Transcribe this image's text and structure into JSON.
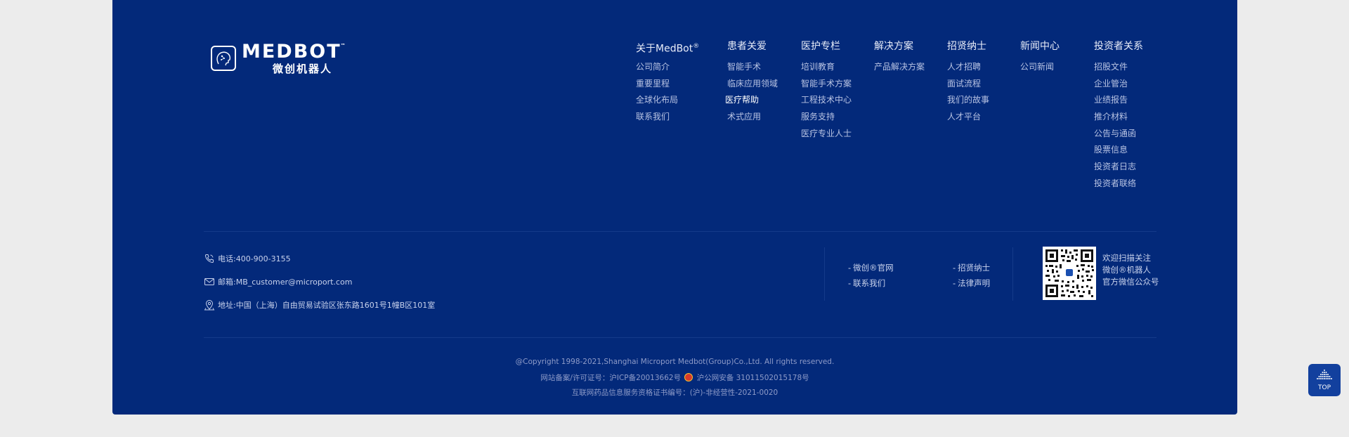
{
  "logo": {
    "text_en": "MEDBOT",
    "tm": "™",
    "text_cn": "微创机器人"
  },
  "nav": [
    {
      "title": "关于MedBot",
      "title_sup": "®",
      "items": [
        "公司简介",
        "重要里程",
        "全球化布局",
        "联系我们"
      ]
    },
    {
      "title": "患者关爱",
      "items": [
        "智能手术",
        "临床应用领域",
        "医疗帮助",
        "术式应用"
      ]
    },
    {
      "title": "医护专栏",
      "items": [
        "培训教育",
        "智能手术方案",
        "工程技术中心",
        "服务支持",
        "医疗专业人士"
      ]
    },
    {
      "title": "解决方案",
      "items": [
        "产品解决方案"
      ]
    },
    {
      "title": "招贤纳士",
      "items": [
        "人才招聘",
        "面试流程",
        "我们的故事",
        "人才平台"
      ]
    },
    {
      "title": "新闻中心",
      "items": [
        "公司新闻"
      ]
    },
    {
      "title": "投资者关系",
      "items": [
        "招股文件",
        "企业管治",
        "业绩报告",
        "推介材料",
        "公告与通函",
        "股票信息",
        "投资者日志",
        "投资者联络"
      ]
    }
  ],
  "contact": {
    "phone": "电话:400-900-3155",
    "email": "邮箱:MB_customer@microport.com",
    "address": "地址:中国（上海）自由贸易试验区张东路1601号1幢B区101室"
  },
  "links": {
    "dash": "-",
    "official_site": "微创®官网",
    "recruit": "招贤纳士",
    "contact_us": "联系我们",
    "legal": "法律声明"
  },
  "qr": {
    "caption_1": "欢迎扫描关注",
    "caption_2": "微创®机器人",
    "caption_3": "官方微信公众号"
  },
  "copyright": {
    "line1": "@Copyright 1998-2021,Shanghai Microport Medbot(Group)Co.,Ltd. All rights reserved.",
    "icp": "网站备案/许可证号：沪ICP备20013662号",
    "police": "沪公网安备 31011502015178号",
    "line3": "互联网药品信息服务资格证书编号：(沪)-非经营性-2021-0020"
  },
  "top_button": {
    "label": "TOP"
  },
  "colors": {
    "background": "#03297a",
    "page": "#ececec",
    "text": "#c9d2ec",
    "muted": "#8e9bc8",
    "top_button": "#12409e"
  }
}
